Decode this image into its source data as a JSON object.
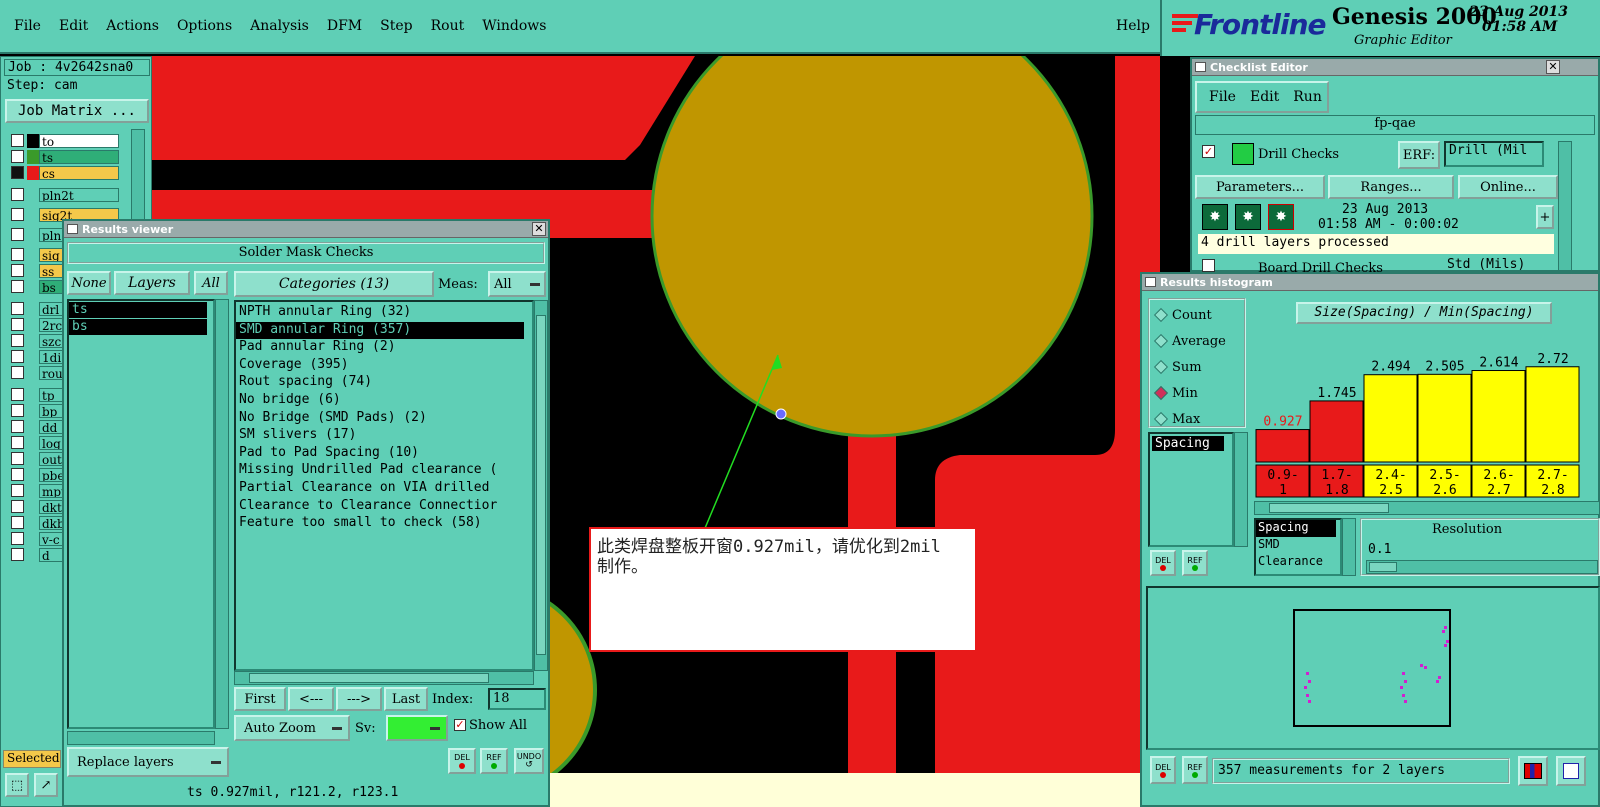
{
  "menubar": {
    "items": [
      "File",
      "Edit",
      "Actions",
      "Options",
      "Analysis",
      "DFM",
      "Step",
      "Rout",
      "Windows"
    ],
    "help": "Help"
  },
  "brand": {
    "logo": "Frontline",
    "product": "Genesis 2000",
    "subtitle": "Graphic Editor",
    "date": "23 Aug 2013",
    "time": "01:58 AM"
  },
  "job": {
    "job_label": "Job : 4v2642sna0",
    "step_label": "Step: cam",
    "matrix_button": "Job Matrix ..."
  },
  "layers": [
    {
      "name": "to",
      "bg": "#ffffff",
      "swatch": "#000000"
    },
    {
      "name": "ts",
      "bg": "#2fae78",
      "swatch": "#3a9a2a"
    },
    {
      "name": "cs",
      "bg": "#f4c84a",
      "swatch": "#e81a1a"
    },
    {
      "name": "pln2t",
      "bg": "#5fcfb6",
      "swatch": "#5fcfb6"
    },
    {
      "name": "sig2t",
      "bg": "#f4c84a",
      "swatch": "#5fcfb6"
    },
    {
      "name": "pln",
      "bg": "#5fcfb6",
      "swatch": "#5fcfb6"
    },
    {
      "name": "sig",
      "bg": "#f4c84a",
      "swatch": "#5fcfb6"
    },
    {
      "name": "ss",
      "bg": "#f4c84a",
      "swatch": "#5fcfb6"
    },
    {
      "name": "bs",
      "bg": "#2fae78",
      "swatch": "#5fcfb6"
    },
    {
      "name": "drl",
      "bg": "#5fcfb6",
      "swatch": "#5fcfb6"
    },
    {
      "name": "2rc",
      "bg": "#5fcfb6",
      "swatch": "#5fcfb6"
    },
    {
      "name": "szc",
      "bg": "#5fcfb6",
      "swatch": "#5fcfb6"
    },
    {
      "name": "1di",
      "bg": "#5fcfb6",
      "swatch": "#5fcfb6"
    },
    {
      "name": "rou",
      "bg": "#5fcfb6",
      "swatch": "#5fcfb6"
    },
    {
      "name": "tp",
      "bg": "#5fcfb6",
      "swatch": "#5fcfb6"
    },
    {
      "name": "bp",
      "bg": "#5fcfb6",
      "swatch": "#5fcfb6"
    },
    {
      "name": "dd",
      "bg": "#5fcfb6",
      "swatch": "#5fcfb6"
    },
    {
      "name": "log",
      "bg": "#5fcfb6",
      "swatch": "#5fcfb6"
    },
    {
      "name": "out",
      "bg": "#5fcfb6",
      "swatch": "#5fcfb6"
    },
    {
      "name": "pbe",
      "bg": "#5fcfb6",
      "swatch": "#5fcfb6"
    },
    {
      "name": "mpt",
      "bg": "#5fcfb6",
      "swatch": "#5fcfb6"
    },
    {
      "name": "dkt",
      "bg": "#5fcfb6",
      "swatch": "#5fcfb6"
    },
    {
      "name": "dkb",
      "bg": "#5fcfb6",
      "swatch": "#5fcfb6"
    },
    {
      "name": "v-c",
      "bg": "#5fcfb6",
      "swatch": "#5fcfb6"
    },
    {
      "name": "d",
      "bg": "#5fcfb6",
      "swatch": "#5fcfb6"
    }
  ],
  "selected_label": "Selected",
  "results_viewer": {
    "title": "Results viewer",
    "header": "Solder Mask Checks",
    "none": "None",
    "layers": "Layers",
    "all": "All",
    "layer_list": [
      "ts",
      "bs"
    ],
    "categories_btn": "Categories (13)",
    "meas_label": "Meas:",
    "meas_value": "All",
    "categories": [
      "NPTH annular Ring (32)",
      "SMD annular Ring (357)",
      "Pad annular Ring (2)",
      "Coverage (395)",
      "Rout spacing (74)",
      "No bridge (6)",
      "No Bridge (SMD Pads) (2)",
      "SM slivers (17)",
      "Pad to Pad Spacing (10)",
      "Missing Undrilled Pad clearance (",
      "Partial Clearance on VIA drilled",
      "Clearance to Clearance Connectior",
      "Feature too small to check (58)"
    ],
    "first": "First",
    "prev": "<---",
    "next": "--->",
    "last": "Last",
    "index_label": "Index:",
    "index_value": "18",
    "auto_zoom": "Auto Zoom",
    "sv_label": "Sv:",
    "show_all": "Show All",
    "replace_layers": "Replace layers",
    "del": "DEL",
    "ref": "REF",
    "undo": "UNDO",
    "status": "ts 0.927mil, r121.2, r123.1"
  },
  "annotation": {
    "text": "此类焊盘整板开窗0.927mil，请优化到2mil制作。"
  },
  "checklist": {
    "title": "Checklist Editor",
    "menu": [
      "File",
      "Edit",
      "Run"
    ],
    "name": "fp-qae",
    "drill_checks": "Drill Checks",
    "erf_label": "ERF:",
    "erf_value": "Drill (Mil",
    "parameters": "Parameters...",
    "ranges": "Ranges...",
    "online": "Online...",
    "date": "23 Aug 2013",
    "time_line": "01:58 AM - 0:00:02",
    "message": "4 drill layers processed",
    "board_drill": "Board Drill Checks",
    "erf_value2": "Std (Mils)"
  },
  "histogram": {
    "title": "Results histogram",
    "options": [
      "Count",
      "Average",
      "Sum",
      "Min",
      "Max"
    ],
    "selected_option": "Min",
    "heading": "Size(Spacing) / Min(Spacing)",
    "measure_list_left": [
      "Spacing"
    ],
    "measure_list": [
      "Spacing",
      "SMD",
      "Clearance"
    ],
    "resolution_label": "Resolution",
    "resolution_value": "0.1",
    "status": "357 measurements for 2 layers",
    "del": "DEL",
    "ref": "REF"
  },
  "chart_data": {
    "type": "bar",
    "categories": [
      "0.9-1",
      "1.7-1.8",
      "2.4-2.5",
      "2.5-2.6",
      "2.6-2.7",
      "2.7-2.8"
    ],
    "values": [
      0.927,
      1.745,
      2.494,
      2.505,
      2.614,
      2.721
    ],
    "value_labels": [
      "0.927",
      "1.745",
      "2.494",
      "2.505",
      "2.614",
      "2.72"
    ],
    "colors": [
      "#e81a1a",
      "#e81a1a",
      "#ffff00",
      "#ffff00",
      "#ffff00",
      "#ffff00"
    ],
    "ylim": [
      0,
      3.2
    ]
  },
  "colors": {
    "panel": "#5fcfb6",
    "copper": "#c09600",
    "mask": "#e81a1a",
    "highlight": "#000000"
  }
}
